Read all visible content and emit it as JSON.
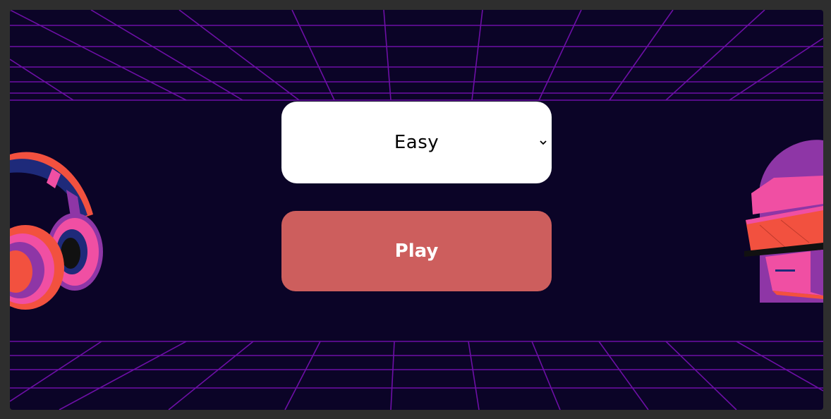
{
  "difficulty": {
    "selected": "Easy",
    "icon": "chevron-down-icon"
  },
  "play_button": {
    "label": "Play"
  },
  "colors": {
    "background": "#0b0427",
    "grid": "#7a10b8",
    "select_bg": "#ffffff",
    "play_bg": "#cd5e5d",
    "play_text": "#ffffff"
  },
  "decorations": {
    "left": "headphones-icon",
    "right": "robot-helmet-icon"
  }
}
